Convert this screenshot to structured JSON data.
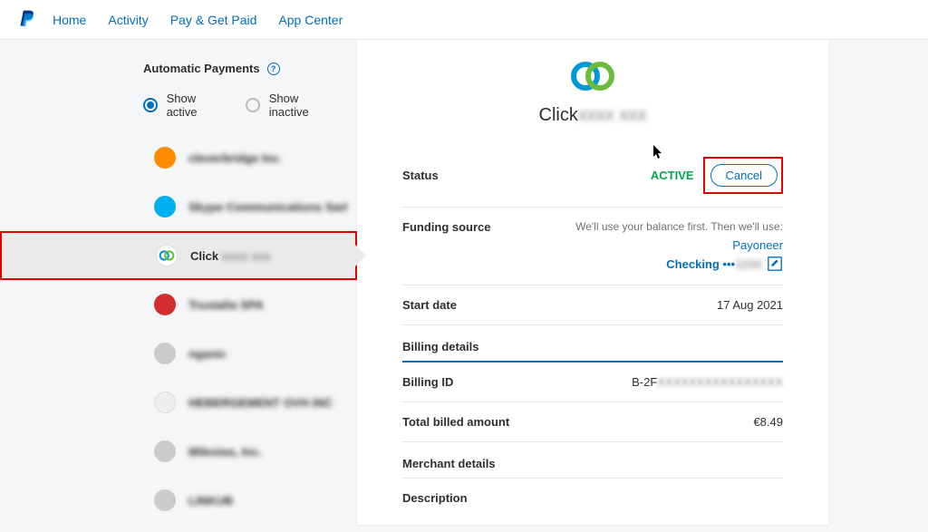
{
  "nav": {
    "links": [
      "Home",
      "Activity",
      "Pay & Get Paid",
      "App Center"
    ]
  },
  "sidebar": {
    "title": "Automatic Payments",
    "show_active": "Show active",
    "show_inactive": "Show inactive",
    "merchants": [
      {
        "name": "cleverbridge Inc.",
        "color": "#ff8c00"
      },
      {
        "name": "Skype Communications Sarl",
        "color": "#00aff0"
      },
      {
        "name": "Click",
        "color": "logo"
      },
      {
        "name": "Trustalia SPA",
        "color": "#d32f2f"
      },
      {
        "name": "nganic",
        "color": "#bbb"
      },
      {
        "name": "HEBERGEMENT OVH INC",
        "color": "#eee"
      },
      {
        "name": "Milestas, Inc.",
        "color": "#bbb"
      },
      {
        "name": "LINKUB",
        "color": "#bbb"
      }
    ]
  },
  "detail": {
    "merchant_name": "Click",
    "status_label": "Status",
    "status_value": "ACTIVE",
    "cancel_label": "Cancel",
    "funding_label": "Funding source",
    "funding_text": "We'll use your balance first. Then we'll use:",
    "funding_provider": "Payoneer",
    "funding_account": "Checking •••",
    "start_date_label": "Start date",
    "start_date_value": "17 Aug 2021",
    "billing_section": "Billing details",
    "billing_id_label": "Billing ID",
    "billing_id_value": "B-2F",
    "total_billed_label": "Total billed amount",
    "total_billed_value": "€8.49",
    "merchant_section": "Merchant details",
    "description_label": "Description"
  }
}
